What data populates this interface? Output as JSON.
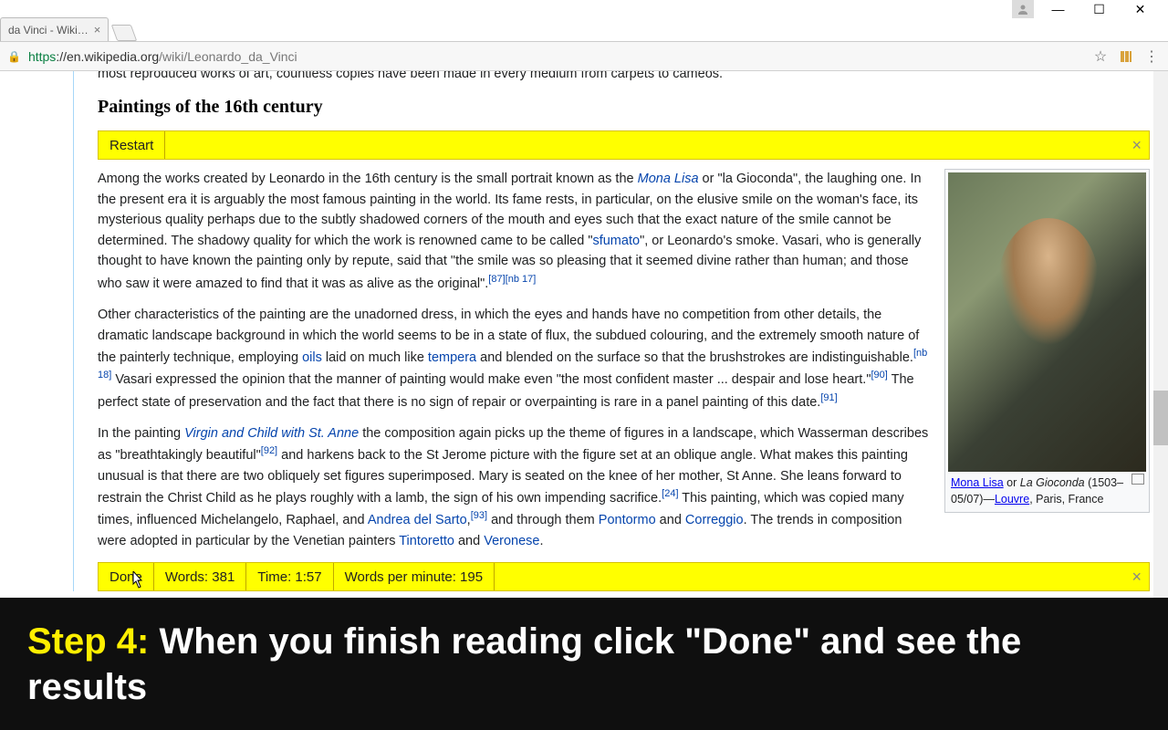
{
  "window": {
    "tab_title": "da Vinci - Wiki…",
    "url_scheme": "https",
    "url_host": "://en.wikipedia.org",
    "url_path": "/wiki/Leonardo_da_Vinci"
  },
  "article": {
    "cut_line": "most reproduced works of art, countless copies have been made in every medium from carpets to cameos.",
    "subheading": "Paintings of the 16th century",
    "restart_label": "Restart",
    "p1_a": "Among the works created by Leonardo in the 16th century is the small portrait known as the ",
    "p1_monalisa": "Mona Lisa",
    "p1_b": " or \"la Gioconda\", the laughing one. In the present era it is arguably the most famous painting in the world. Its fame rests, in particular, on the elusive smile on the woman's face, its mysterious quality perhaps due to the subtly shadowed corners of the mouth and eyes such that the exact nature of the smile cannot be determined. The shadowy quality for which the work is renowned came to be called \"",
    "p1_sfumato": "sfumato",
    "p1_c": "\", or Leonardo's smoke. Vasari, who is generally thought to have known the painting only by repute, said that \"the smile was so pleasing that it seemed divine rather than human; and those who saw it were amazed to find that it was as alive as the original\".",
    "ref_87": "[87]",
    "ref_nb17": "[nb 17]",
    "p2_a": "Other characteristics of the painting are the unadorned dress, in which the eyes and hands have no competition from other details, the dramatic landscape background in which the world seems to be in a state of flux, the subdued colouring, and the extremely smooth nature of the painterly technique, employing ",
    "p2_oils": "oils",
    "p2_b": " laid on much like ",
    "p2_tempera": "tempera",
    "p2_c": " and blended on the surface so that the brushstrokes are indistinguishable.",
    "ref_nb18": "[nb 18]",
    "p2_d": " Vasari expressed the opinion that the manner of painting would make even \"the most confident master ... despair and lose heart.\"",
    "ref_90": "[90]",
    "p2_e": " The perfect state of preservation and the fact that there is no sign of repair or overpainting is rare in a panel painting of this date.",
    "ref_91": "[91]",
    "p3_a": "In the painting ",
    "p3_virgin": "Virgin and Child with St. Anne",
    "p3_b": " the composition again picks up the theme of figures in a landscape, which Wasserman describes as \"breathtakingly beautiful\"",
    "ref_92": "[92]",
    "p3_c": " and harkens back to the St Jerome picture with the figure set at an oblique angle. What makes this painting unusual is that there are two obliquely set figures superimposed. Mary is seated on the knee of her mother, St Anne. She leans forward to restrain the Christ Child as he plays roughly with a lamb, the sign of his own impending sacrifice.",
    "ref_24": "[24]",
    "p3_d": " This painting, which was copied many times, influenced Michelangelo, Raphael, and ",
    "p3_andrea": "Andrea del Sarto",
    "p3_comma": ",",
    "ref_93": "[93]",
    "p3_e": " and through them ",
    "p3_pontormo": "Pontormo",
    "p3_and": " and ",
    "p3_correggio": "Correggio",
    "p3_f": ". The trends in composition were adopted in particular by the Venetian painters ",
    "p3_tintoretto": "Tintoretto",
    "p3_and2": " and ",
    "p3_veronese": "Veronese",
    "p3_g": "."
  },
  "thumb": {
    "name_link": "Mona Lisa",
    "or": " or ",
    "alt_name": "La Gioconda",
    "dates": " (1503–05/07)—",
    "louvre": "Louvre",
    "rest": ", Paris, France"
  },
  "stats": {
    "done_label": "Done",
    "words": "Words: 381",
    "time": "Time: 1:57",
    "wpm": "Words per minute: 195"
  },
  "instruction": {
    "step": "Step 4: ",
    "text": "When you finish reading click \"Done\" and see the results"
  }
}
